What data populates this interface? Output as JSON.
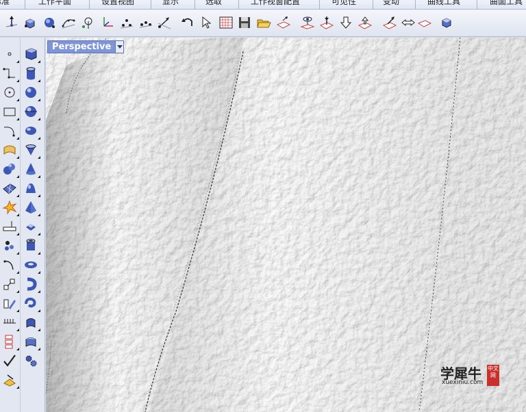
{
  "menu": {
    "tabs": [
      "标准",
      "工作平面",
      "设置视图",
      "显示",
      "选取",
      "工作视窗配置",
      "可见性",
      "变动",
      "曲线工具",
      "曲面工具"
    ]
  },
  "toolbar": {
    "tools": [
      "point-edit-icon",
      "box-edit-icon",
      "sphere-edit-icon",
      "curve-edit-icon",
      "rotate-edit-icon",
      "axis-icon",
      "dots-icon",
      "dots-curve-icon",
      "move-icon",
      "sync-icon",
      "undo-icon",
      "select-icon",
      "grid-icon",
      "save-icon",
      "open-icon",
      "plane-icon",
      "eye-plane-icon",
      "pin-icon",
      "down-arrow-icon",
      "up-arrow-icon",
      "arrow-plane-icon",
      "left-right-icon",
      "cube-icon"
    ]
  },
  "left_toolbar": {
    "col1": [
      "point-icon",
      "polyline-icon",
      "circle-icon",
      "rectangle-icon",
      "curve-icon",
      "surface-icon",
      "solid-spheres-icon",
      "mesh-icon",
      "explode-icon",
      "dimension-icon",
      "group-icon",
      "fillet-icon",
      "transform-icon",
      "edit-icon",
      "move-grid-icon",
      "array-icon",
      "check-icon",
      "paint-icon"
    ],
    "col2": [
      "box-icon",
      "cylinder-icon",
      "sphere-icon",
      "ellipsoid-icon",
      "cone-icon",
      "paraboloid-icon",
      "pyramid-icon",
      "truncated-cone-icon",
      "pyramid-solid-icon",
      "tube-icon",
      "torus-icon",
      "pipe-icon",
      "twist-icon",
      "extrude-icon",
      "extrude-surface-icon",
      "gear-icon"
    ]
  },
  "viewport": {
    "label": "Perspective"
  },
  "watermark": {
    "text": "学犀牛",
    "url": "xuexiniu.com",
    "seal": "中文网"
  },
  "colors": {
    "viewport_label_bg": "#7e96d8",
    "toolbar_bg": "#e3e7f1",
    "seal_red": "#c9302c"
  }
}
